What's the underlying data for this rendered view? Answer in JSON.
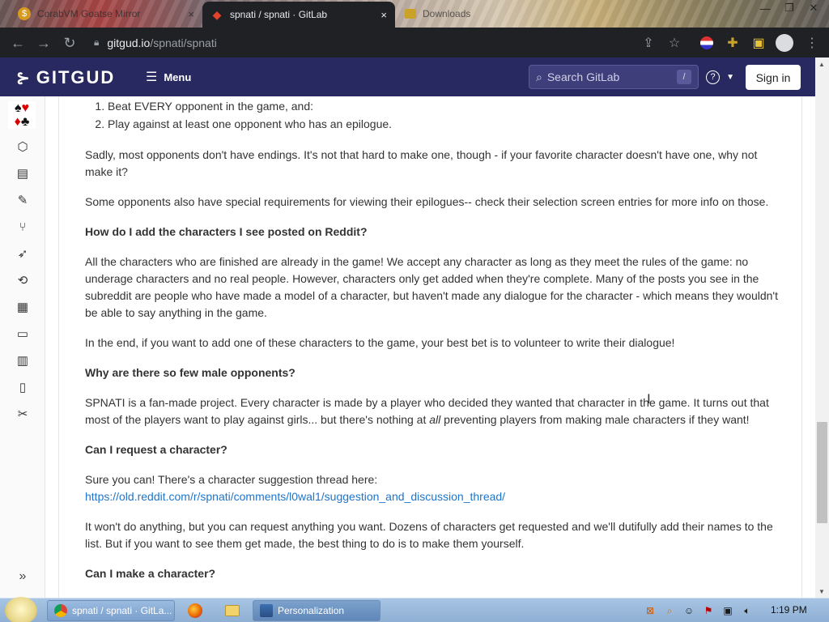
{
  "browser": {
    "tabs": [
      {
        "label": "CorabVM Goatse Mirror",
        "favicon": "coin-icon",
        "close": "×"
      },
      {
        "label": "spnati / spnati · GitLab",
        "favicon": "gitlab-icon",
        "close": "×"
      },
      {
        "label": "Downloads",
        "favicon": "folder-icon"
      }
    ],
    "address": {
      "host": "gitgud.io",
      "path": "/spnati/spnati"
    }
  },
  "gitlab": {
    "logo": "GITGUD",
    "menu_label": "Menu",
    "search_placeholder": "Search GitLab",
    "search_shortcut": "/",
    "help_label": "?",
    "signin_label": "Sign in"
  },
  "doc": {
    "list": [
      "Beat EVERY opponent in the game, and:",
      "Play against at least one opponent who has an epilogue."
    ],
    "p1": "Sadly, most opponents don't have endings. It's not that hard to make one, though - if your favorite character doesn't have one, why not make it?",
    "p2": "Some opponents also have special requirements for viewing their epilogues-- check their selection screen entries for more info on those.",
    "h1": "How do I add the characters I see posted on Reddit?",
    "p3": "All the characters who are finished are already in the game! We accept any character as long as they meet the rules of the game: no underage characters and no real people. However, characters only get added when they're complete. Many of the posts you see in the subreddit are people who have made a model of a character, but haven't made any dialogue for the character - which means they wouldn't be able to say anything in the game.",
    "p4": "In the end, if you want to add one of these characters to the game, your best bet is to volunteer to write their dialogue!",
    "h2": "Why are there so few male opponents?",
    "p5_a": "SPNATI is a fan-made project. Every character is made by a player who decided they wanted that character in the game. It turns out that most of the players want to play against girls... but there's nothing at ",
    "p5_em": "all",
    "p5_b": " preventing players from making male characters if they want!",
    "h3": "Can I request a character?",
    "p6": "Sure you can! There's a character suggestion thread here:",
    "link": "https://old.reddit.com/r/spnati/comments/l0wal1/suggestion_and_discussion_thread/",
    "p7": "It won't do anything, but you can request anything you want. Dozens of characters get requested and we'll dutifully add their names to the list. But if you want to see them get made, the best thing to do is to make them yourself.",
    "h4": "Can I make a character?"
  },
  "taskbar": {
    "tasks": [
      {
        "label": "spnati / spnati · GitLa...",
        "icon": "chrome-icon"
      },
      {
        "label": "Personalization",
        "icon": "personalization-icon"
      }
    ],
    "clock": "1:19 PM"
  },
  "colors": {
    "gitlab_header": "#292961",
    "link": "#1f75cb",
    "browser_chrome": "#202124"
  }
}
